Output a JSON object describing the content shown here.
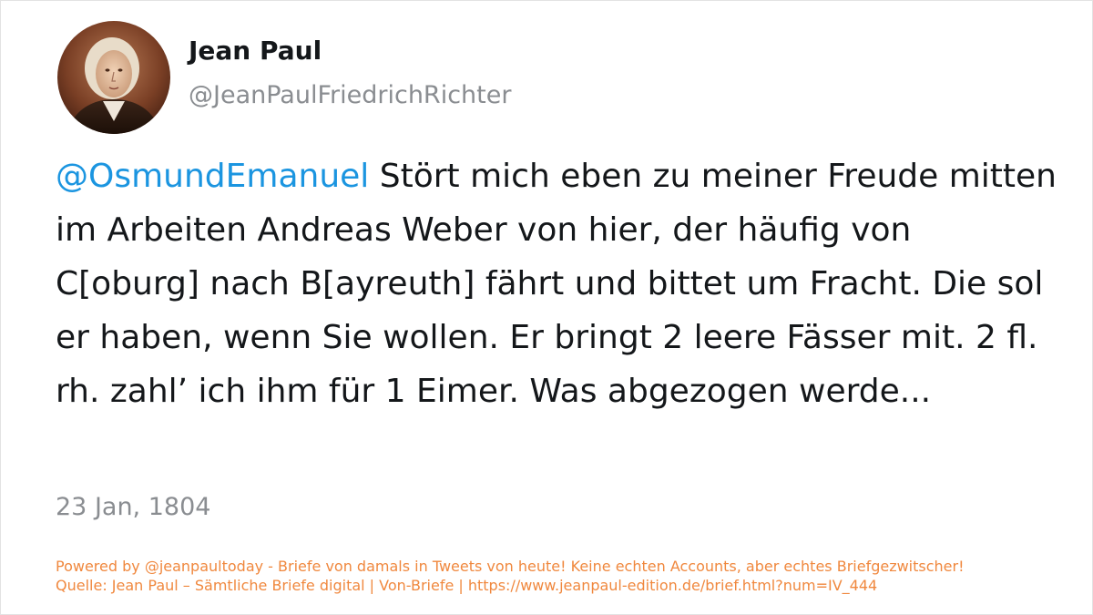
{
  "author": {
    "display_name": "Jean Paul",
    "handle": "@JeanPaulFriedrichRichter"
  },
  "tweet": {
    "mention": "@OsmundEmanuel",
    "text": " Stört mich eben zu meiner Freude mitten im Arbeiten Andreas Weber von hier, der häufig von C[oburg] nach B[ayreuth] fährt und bittet um Fracht. Die sol er haben, wenn Sie wollen. Er bringt 2 leere Fässer mit. 2 fl. rh. zahl’ ich ihm für 1 Eimer. Was abgezogen werde...",
    "date": "23 Jan, 1804"
  },
  "footer": {
    "powered_by": "Powered by @jeanpaultoday - Briefe von damals in Tweets von heute! Keine echten Accounts, aber echtes Briefgezwitscher!",
    "source": "Quelle: Jean Paul – Sämtliche Briefe digital | Von-Briefe | https://www.jeanpaul-edition.de/brief.html?num=IV_444"
  },
  "colors": {
    "mention": "#1b95e0",
    "footer": "#f0883e",
    "text": "#14171a",
    "muted": "#8a8d91"
  }
}
